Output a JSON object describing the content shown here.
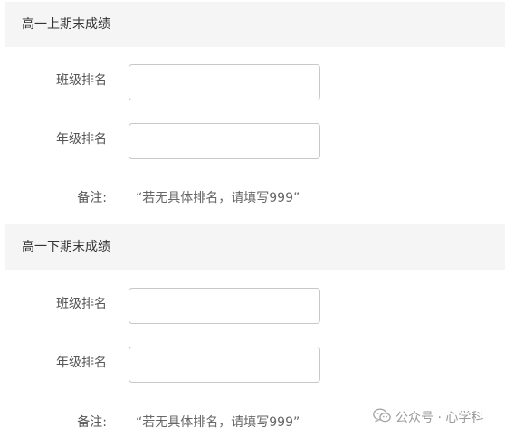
{
  "sections": [
    {
      "title": "高一上期末成绩",
      "fields": [
        {
          "label": "班级排名",
          "value": ""
        },
        {
          "label": "年级排名",
          "value": ""
        }
      ],
      "note_label": "备注:",
      "note_text": "“若无具体排名，请填写999”"
    },
    {
      "title": "高一下期末成绩",
      "fields": [
        {
          "label": "班级排名",
          "value": ""
        },
        {
          "label": "年级排名",
          "value": ""
        }
      ],
      "note_label": "备注:",
      "note_text": "“若无具体排名，请填写999”"
    }
  ],
  "watermark": {
    "icon": "wechat-icon",
    "text": "公众号 · 心学科"
  }
}
